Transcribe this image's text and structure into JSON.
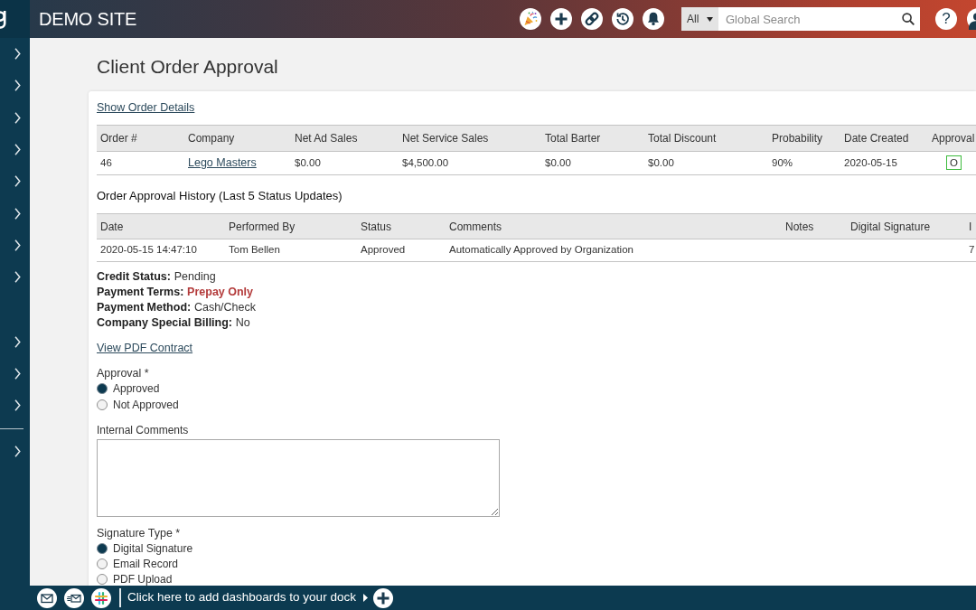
{
  "sidebar": {
    "groups": [
      {
        "rule_above": false,
        "items": [
          {
            "expanded": false
          },
          {
            "expanded": false
          },
          {
            "expanded": false
          },
          {
            "expanded": false
          },
          {
            "expanded": false
          },
          {
            "expanded": false
          },
          {
            "expanded": false
          },
          {
            "expanded": false
          }
        ]
      },
      {
        "rule_above": false,
        "items": [
          {
            "expanded": false
          },
          {
            "expanded": false
          },
          {
            "expanded": false
          }
        ]
      },
      {
        "rule_above": true,
        "items": [
          {
            "expanded": false
          }
        ]
      }
    ]
  },
  "header": {
    "site_name": "DEMO SITE",
    "search": {
      "scope": "All",
      "placeholder": "Global Search"
    },
    "help": "?"
  },
  "page_title": "Client Order Approval",
  "order_details_link": "Show Order Details",
  "orders_table": {
    "columns": [
      "Order #",
      "Company",
      "Net Ad Sales",
      "Net Service Sales",
      "Total Barter",
      "Total Discount",
      "Probability",
      "Date Created",
      "Approval"
    ],
    "rows": [
      {
        "cells": [
          {
            "kind": "text",
            "text": "46"
          },
          {
            "kind": "link",
            "text": "Lego Masters"
          },
          {
            "kind": "text",
            "text": "$0.00"
          },
          {
            "kind": "text",
            "text": "$4,500.00"
          },
          {
            "kind": "text",
            "text": "$0.00"
          },
          {
            "kind": "text",
            "text": "$0.00"
          },
          {
            "kind": "text",
            "text": "90%"
          },
          {
            "kind": "text",
            "text": "2020-05-15"
          },
          {
            "kind": "badge",
            "text": "O"
          }
        ]
      }
    ]
  },
  "history": {
    "title": "Order Approval History (Last 5 Status Updates)",
    "columns": [
      "Date",
      "Performed By",
      "Status",
      "Comments",
      "Notes",
      "Digital Signature",
      "I"
    ],
    "rows": [
      [
        "2020-05-15 14:47:10",
        "Tom Bellen",
        "Approved",
        "Automatically Approved by Organization",
        null,
        null,
        "7"
      ]
    ]
  },
  "account_info": [
    {
      "label": "Credit Status:",
      "value": "Pending",
      "alert": false
    },
    {
      "label": "Payment Terms:",
      "value": "Prepay Only",
      "alert": true
    },
    {
      "label": "Payment Method:",
      "value": "Cash/Check",
      "alert": false
    },
    {
      "label": "Company Special Billing:",
      "value": "No",
      "alert": false
    }
  ],
  "contract_link": "View PDF Contract",
  "approval": {
    "label": "Approval *",
    "options": [
      {
        "label": "Approved",
        "selected": true
      },
      {
        "label": "Not Approved",
        "selected": false
      }
    ]
  },
  "internal_comments": {
    "label": "Internal Comments"
  },
  "signature_type": {
    "label": "Signature Type *",
    "options": [
      {
        "label": "Digital Signature",
        "selected": true
      },
      {
        "label": "Email Record",
        "selected": false
      },
      {
        "label": "PDF Upload",
        "selected": false
      }
    ]
  },
  "dock": {
    "message": "Click here to add dashboards to your dock"
  }
}
